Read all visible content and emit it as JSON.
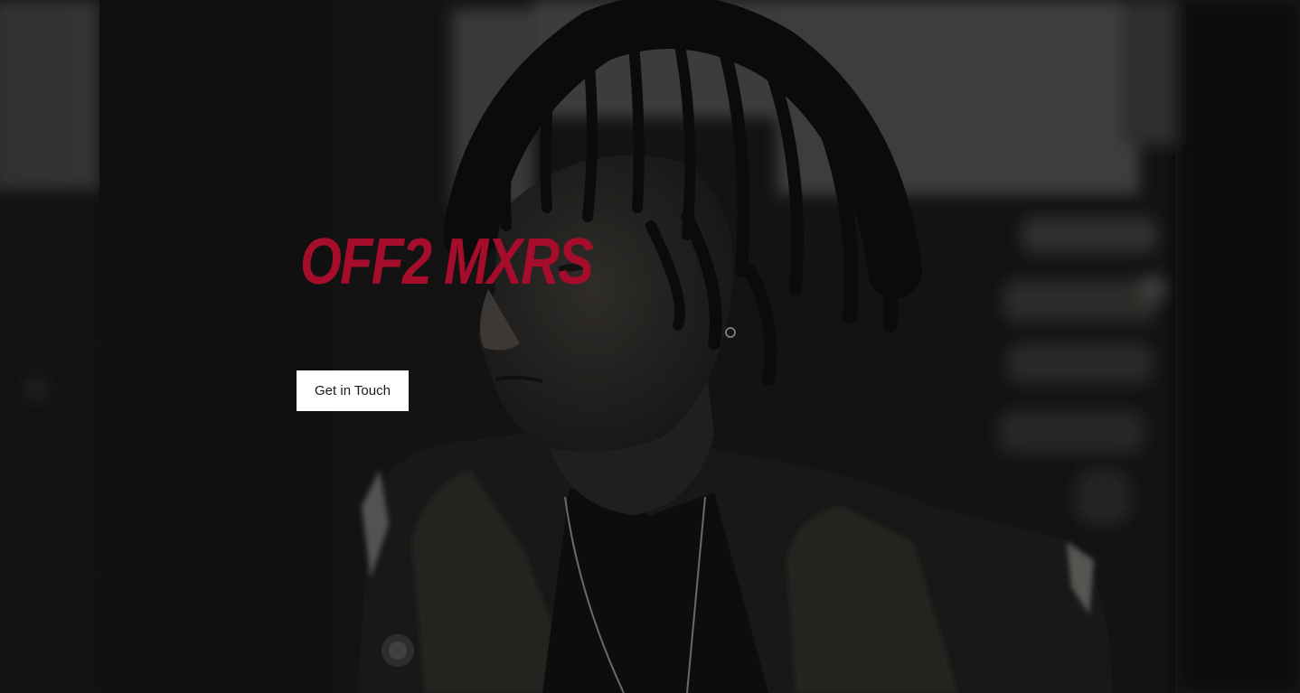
{
  "hero": {
    "title": "OFF2 MXRS",
    "cta_label": "Get in Touch"
  },
  "colors": {
    "title": "#a50d2b",
    "button_bg": "#ffffff",
    "button_text": "#1a1a1a",
    "overlay": "#0f0f0f"
  },
  "icons": {
    "background": "monochrome-portrait-photo"
  }
}
